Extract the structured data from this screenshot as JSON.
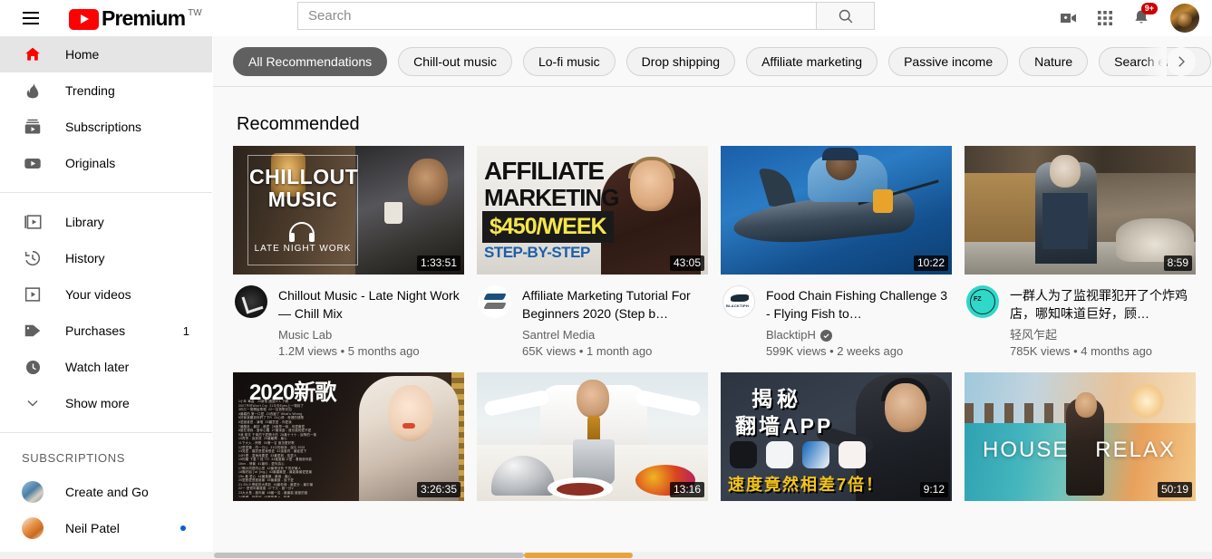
{
  "header": {
    "menu_icon": "hamburger-icon",
    "logo_text": "Premium",
    "country_code": "TW",
    "search": {
      "value": "",
      "placeholder": "Search"
    },
    "search_icon": "search-icon",
    "create_icon": "video-add-icon",
    "apps_icon": "apps-grid-icon",
    "notifications_icon": "bell-icon",
    "notifications_badge": "9+",
    "avatar": "user-avatar"
  },
  "sidebar": {
    "primary": [
      {
        "label": "Home",
        "icon": "home-icon",
        "active": true
      },
      {
        "label": "Trending",
        "icon": "flame-icon",
        "active": false
      },
      {
        "label": "Subscriptions",
        "icon": "subscriptions-icon",
        "active": false
      },
      {
        "label": "Originals",
        "icon": "originals-icon",
        "active": false
      }
    ],
    "library": [
      {
        "label": "Library",
        "icon": "library-icon",
        "count": ""
      },
      {
        "label": "History",
        "icon": "history-icon",
        "count": ""
      },
      {
        "label": "Your videos",
        "icon": "your-videos-icon",
        "count": ""
      },
      {
        "label": "Purchases",
        "icon": "tag-icon",
        "count": "1"
      },
      {
        "label": "Watch later",
        "icon": "clock-icon",
        "count": ""
      },
      {
        "label": "Show more",
        "icon": "chevron-down-icon",
        "count": ""
      }
    ],
    "subscriptions_header": "SUBSCRIPTIONS",
    "subscriptions": [
      {
        "name": "Create and Go",
        "new": false
      },
      {
        "name": "Neil Patel",
        "new": true
      }
    ]
  },
  "chips": {
    "items": [
      {
        "label": "All Recommendations",
        "selected": true
      },
      {
        "label": "Chill-out music",
        "selected": false
      },
      {
        "label": "Lo-fi music",
        "selected": false
      },
      {
        "label": "Drop shipping",
        "selected": false
      },
      {
        "label": "Affiliate marketing",
        "selected": false
      },
      {
        "label": "Passive income",
        "selected": false
      },
      {
        "label": "Nature",
        "selected": false
      },
      {
        "label": "Search engine",
        "selected": false
      }
    ],
    "next_icon": "chevron-right-icon"
  },
  "main": {
    "section_title": "Recommended",
    "videos": [
      {
        "title": "Chillout Music - Late Night Work — Chill Mix",
        "channel": "Music Lab",
        "verified": false,
        "stats": "1.2M views • 5 months ago",
        "duration": "1:33:51",
        "thumb_text": {
          "line1": "CHILLOUT",
          "line2": "MUSIC",
          "line3": "LATE NIGHT WORK"
        }
      },
      {
        "title": "Affiliate Marketing Tutorial For Beginners 2020 (Step b…",
        "channel": "Santrel Media",
        "verified": false,
        "stats": "65K views • 1 month ago",
        "duration": "43:05",
        "thumb_text": {
          "line1": "AFFILIATE",
          "line2": "MARKETING",
          "line3": "$450/WEEK",
          "line4": "STEP-BY-STEP"
        }
      },
      {
        "title": "Food Chain Fishing Challenge 3 - Flying Fish to…",
        "channel": "BlacktipH",
        "verified": true,
        "stats": "599K views • 2 weeks ago",
        "duration": "10:22",
        "thumb_text": {}
      },
      {
        "title": "一群人为了监视罪犯开了个炸鸡店，哪知味道巨好，顾…",
        "channel": "轻风乍起",
        "verified": false,
        "stats": "785K views • 4 months ago",
        "duration": "8:59",
        "thumb_text": {}
      },
      {
        "title": "",
        "channel": "",
        "verified": false,
        "stats": "",
        "duration": "3:26:35",
        "thumb_text": {
          "line1": "2020新歌"
        }
      },
      {
        "title": "",
        "channel": "",
        "verified": false,
        "stats": "",
        "duration": "13:16",
        "thumb_text": {}
      },
      {
        "title": "",
        "channel": "",
        "verified": false,
        "stats": "",
        "duration": "9:12",
        "thumb_text": {
          "line1": "揭秘",
          "line2": "翻墙APP",
          "line3": "速度竟然相差7倍！"
        }
      },
      {
        "title": "",
        "channel": "",
        "verified": false,
        "stats": "",
        "duration": "50:19",
        "thumb_text": {
          "line1": "HOUSE",
          "line2": "RELAX"
        }
      }
    ]
  },
  "colors": {
    "brand_red": "#ff0000",
    "badge_red": "#cc0000",
    "chip_selected": "#606060",
    "page_bg": "#f9f9f9",
    "new_dot_blue": "#065fd4"
  }
}
